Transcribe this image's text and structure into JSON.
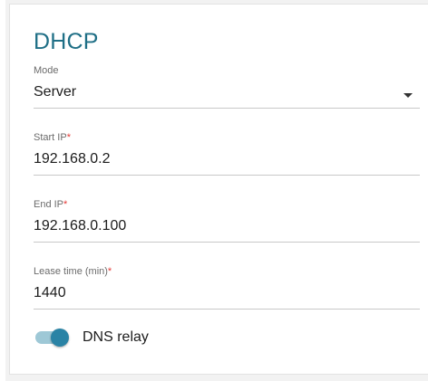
{
  "section": {
    "title": "DHCP"
  },
  "fields": {
    "mode": {
      "label": "Mode",
      "value": "Server"
    },
    "start_ip": {
      "label": "Start IP",
      "required_mark": "*",
      "value": "192.168.0.2"
    },
    "end_ip": {
      "label": "End IP",
      "required_mark": "*",
      "value": "192.168.0.100"
    },
    "lease_time": {
      "label": "Lease time (min)",
      "required_mark": "*",
      "value": "1440"
    }
  },
  "dns_relay": {
    "label": "DNS relay",
    "enabled": true
  },
  "colors": {
    "title": "#1f6f86",
    "toggle_knob": "#2a83a5",
    "toggle_track": "#9ec8d6",
    "required": "#e53935"
  }
}
